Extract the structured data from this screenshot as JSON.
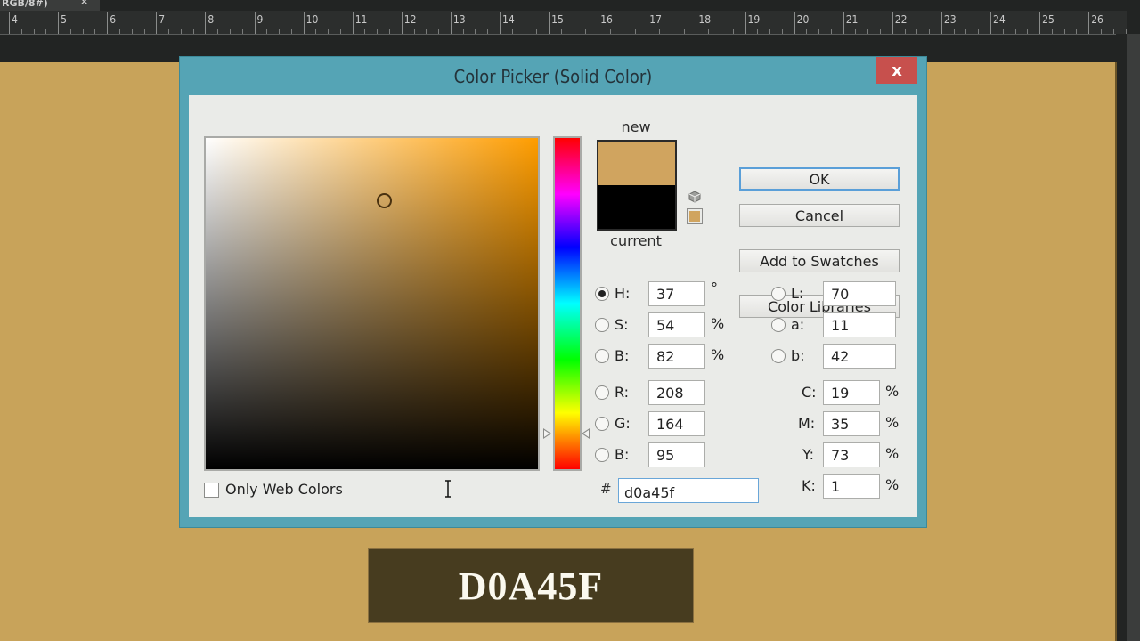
{
  "app": {
    "doc_tab_label": "RGB/8#)",
    "doc_tab_close": "×",
    "ruler_labels": [
      "4",
      "5",
      "6",
      "7",
      "8",
      "9",
      "10",
      "11",
      "12",
      "13",
      "14",
      "15",
      "16",
      "17",
      "18",
      "19",
      "20",
      "21",
      "22",
      "23",
      "24",
      "25",
      "26"
    ]
  },
  "canvas": {
    "fill_color": "#c8a35a",
    "overlay_text": "D0A45F"
  },
  "dialog": {
    "title": "Color Picker (Solid Color)",
    "close_label": "x",
    "selected_hue_deg": 37,
    "buttons": {
      "ok": "OK",
      "cancel": "Cancel",
      "add_to_swatches": "Add to Swatches",
      "color_libraries": "Color Libraries"
    },
    "swatch": {
      "new_label": "new",
      "current_label": "current",
      "new_color": "#d0a45f",
      "current_color": "#000000"
    },
    "icons": {
      "gamut": "cube-icon",
      "web_safe": "web-safe-swatch-icon"
    },
    "hsb": [
      {
        "label": "H:",
        "value": "37",
        "unit": "°",
        "selected": true
      },
      {
        "label": "S:",
        "value": "54",
        "unit": "%",
        "selected": false
      },
      {
        "label": "B:",
        "value": "82",
        "unit": "%",
        "selected": false
      }
    ],
    "rgb": [
      {
        "label": "R:",
        "value": "208",
        "selected": false
      },
      {
        "label": "G:",
        "value": "164",
        "selected": false
      },
      {
        "label": "B:",
        "value": "95",
        "selected": false
      }
    ],
    "lab": [
      {
        "label": "L:",
        "value": "70",
        "selected": false
      },
      {
        "label": "a:",
        "value": "11",
        "selected": false
      },
      {
        "label": "b:",
        "value": "42",
        "selected": false
      }
    ],
    "cmyk": [
      {
        "label": "C:",
        "value": "19",
        "unit": "%"
      },
      {
        "label": "M:",
        "value": "35",
        "unit": "%"
      },
      {
        "label": "Y:",
        "value": "73",
        "unit": "%"
      },
      {
        "label": "K:",
        "value": "1",
        "unit": "%"
      }
    ],
    "hex": {
      "hash": "#",
      "value": "d0a45f"
    },
    "only_web_colors": {
      "label": "Only Web Colors",
      "checked": false
    }
  }
}
